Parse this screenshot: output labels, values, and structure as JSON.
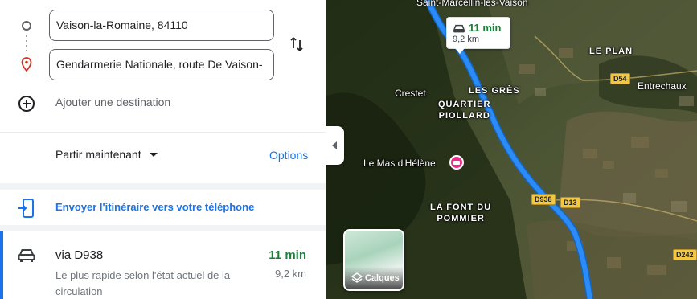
{
  "directions": {
    "origin": "Vaison-la-Romaine, 84110",
    "destination": "Gendarmerie Nationale, route De Vaison-",
    "add_destination": "Ajouter une destination",
    "depart_label": "Partir maintenant",
    "options_label": "Options",
    "send_to_phone": "Envoyer l'itinéraire vers votre téléphone"
  },
  "route": {
    "via": "via D938",
    "time": "11 min",
    "description": "Le plus rapide selon l'état actuel de la circulation",
    "distance": "9,2 km"
  },
  "map": {
    "time_bubble": {
      "time": "11 min",
      "distance": "9,2 km"
    },
    "place_labels": {
      "saint_marcellin": "Saint-Marcellin-lès-Vaison",
      "le_plan": "LE PLAN",
      "entrechaux": "Entrechaux",
      "crestet": "Crestet",
      "les_gres": "LES GRÈS",
      "quartier_piollard": "QUARTIER\nPIOLLARD",
      "le_mas": "Le Mas d'Hélène",
      "la_font": "LA FONT DU\nPOMMIER"
    },
    "roads": {
      "d54": "D54",
      "d938": "D938",
      "d13": "D13",
      "d242": "D242"
    },
    "layers_label": "Calques"
  },
  "colors": {
    "accent": "#1a73e8",
    "route_line": "#2b8cf7",
    "time_green": "#188038",
    "poi_pink": "#e8308a"
  },
  "icons": [
    "origin-circle-icon",
    "destination-pin-icon",
    "swap-icon",
    "add-circle-icon",
    "phone-icon",
    "car-icon",
    "layers-icon",
    "collapse-arrow-icon",
    "hotel-icon"
  ]
}
